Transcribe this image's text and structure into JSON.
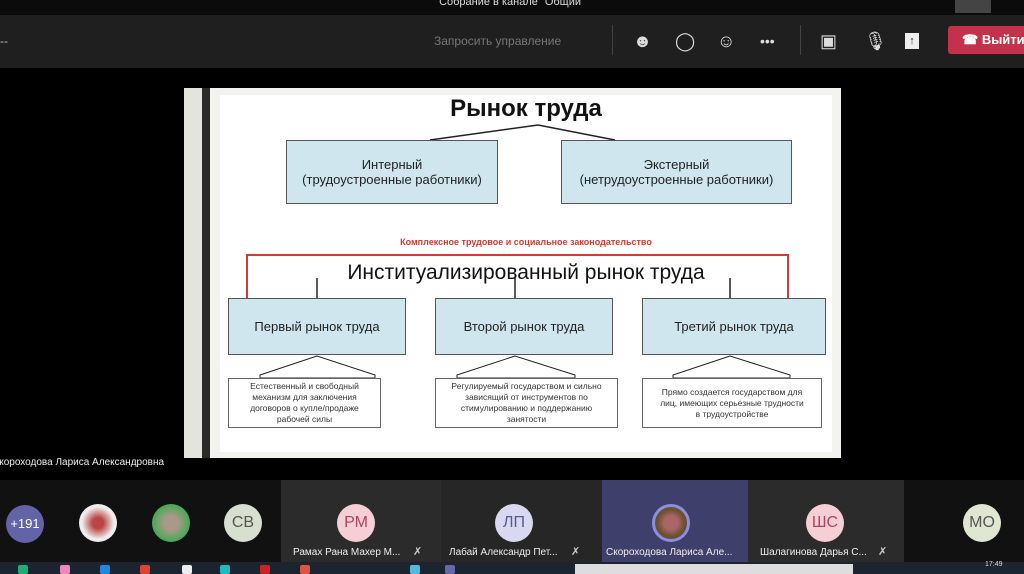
{
  "window": {
    "title": "Собрание в канале \"Общий\""
  },
  "toolbar": {
    "timer": "--",
    "request_control": "Запросить управление",
    "leave_label": "Выйти"
  },
  "slide": {
    "title": "Рынок труда",
    "internal": [
      "Интерный",
      "(трудоустроенные работники)"
    ],
    "external": [
      "Экстерный",
      "(нетрудоустроенные работники)"
    ],
    "legislation": "Комплексное трудовое и социальное законодательство",
    "inst_title": "Институализированный рынок труда",
    "markets": [
      {
        "name": "Первый рынок труда",
        "desc": "Естественный и свободный механизм для заключения договоров о купле/продаже рабочей силы"
      },
      {
        "name": "Второй рынок труда",
        "desc": "Регулируемый государством и сильно зависящий от инструментов по стимулированию и поддержанию занятости"
      },
      {
        "name": "Третий рынок труда",
        "desc": "Прямо создается государством для лиц, имеющих серьезные трудности в трудоустройстве"
      }
    ]
  },
  "presenter_name": "Скороходова Лариса Александровна",
  "participants": {
    "overflow": "+191",
    "avatars": [
      {
        "initials": "СВ"
      },
      {
        "initials": "МО"
      }
    ],
    "tiles": [
      {
        "initials": "РМ",
        "name": "Рамах Рана Махер М..."
      },
      {
        "initials": "ЛП",
        "name": "Лабай Александр Пет..."
      },
      {
        "initials": "",
        "name": "Скороходова Лариса Але..."
      },
      {
        "initials": "ШС",
        "name": "Шалагинова Дарья С..."
      }
    ]
  },
  "taskbar": {
    "time": "17:49"
  },
  "colors": {
    "leave": "#c4314b",
    "accent": "#6264a7",
    "slide_box": "#cfe6ef",
    "legislation_red": "#d63a2f"
  }
}
